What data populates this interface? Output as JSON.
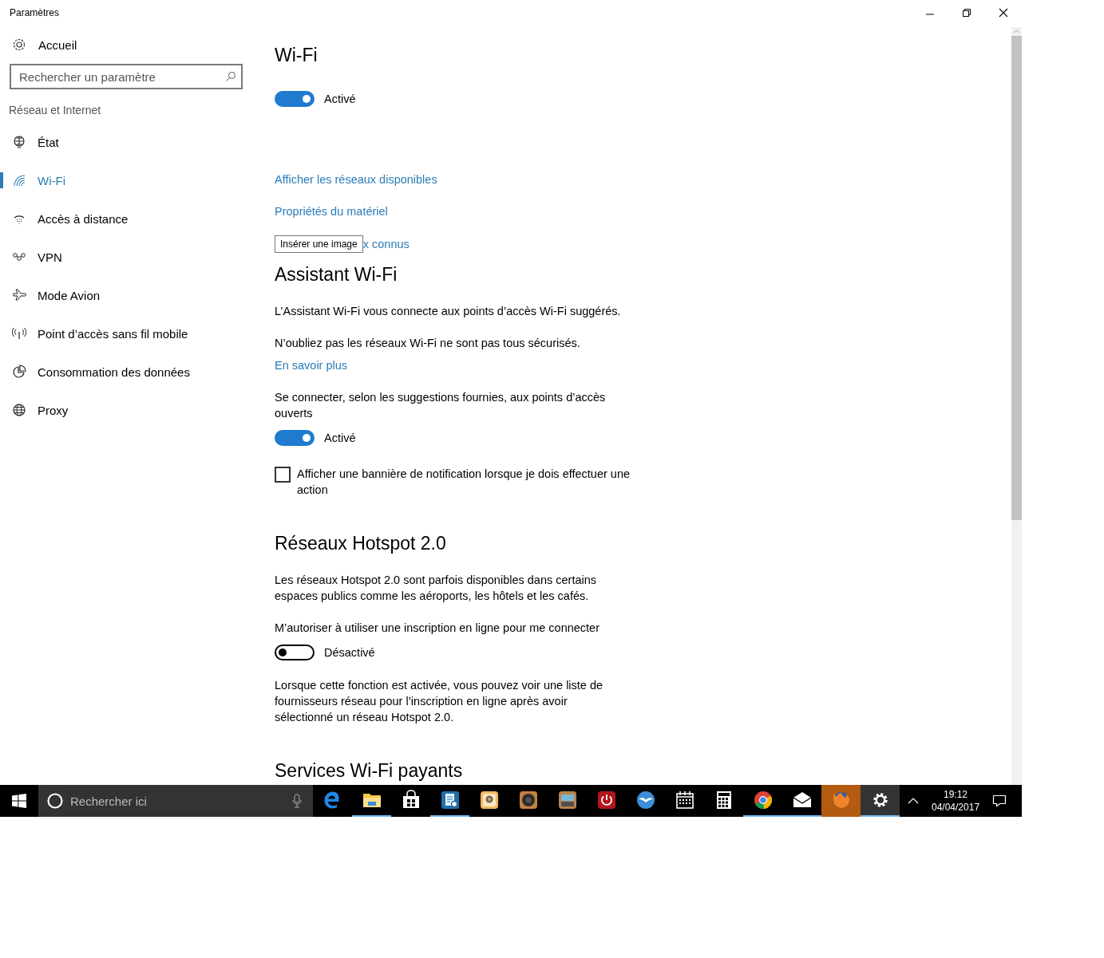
{
  "window": {
    "title": "Paramètres",
    "controls": [
      {
        "kind": "minimize"
      },
      {
        "kind": "restore"
      },
      {
        "kind": "close"
      }
    ]
  },
  "sidebar": {
    "home": {
      "label": "Accueil"
    },
    "search": {
      "placeholder": "Rechercher un paramètre"
    },
    "section": "Réseau et Internet",
    "items": [
      {
        "label": "État",
        "selected": false
      },
      {
        "label": "Wi-Fi",
        "selected": true
      },
      {
        "label": "Accès à distance",
        "selected": false
      },
      {
        "label": "VPN",
        "selected": false
      },
      {
        "label": "Mode Avion",
        "selected": false
      },
      {
        "label": "Point d’accès sans fil mobile",
        "selected": false
      },
      {
        "label": "Consommation des données",
        "selected": false
      },
      {
        "label": "Proxy",
        "selected": false
      }
    ]
  },
  "content": [
    {
      "kind": "title",
      "text": "Wi-Fi"
    },
    {
      "kind": "toggle",
      "on": true,
      "label": "Activé"
    },
    {
      "kind": "link",
      "text": "Afficher les réseaux disponibles"
    },
    {
      "kind": "link",
      "text": "Propriétés du matériel"
    },
    {
      "kind": "link",
      "text": "x connus",
      "tooltip": "Insérer une image"
    },
    {
      "kind": "heading",
      "text": "Assistant Wi-Fi"
    },
    {
      "kind": "text",
      "text": "L’Assistant Wi-Fi vous connecte aux points d’accès Wi-Fi suggérés."
    },
    {
      "kind": "text",
      "text": "N’oubliez pas les réseaux Wi-Fi ne sont pas tous sécurisés."
    },
    {
      "kind": "link",
      "text": "En savoir plus"
    },
    {
      "kind": "text",
      "text": "Se connecter, selon les suggestions fournies, aux points d’accès ouverts"
    },
    {
      "kind": "toggle",
      "on": true,
      "label": "Activé"
    },
    {
      "kind": "checkbox",
      "checked": false,
      "label": "Afficher une bannière de notification lorsque je dois effectuer une action"
    },
    {
      "kind": "heading",
      "text": "Réseaux Hotspot 2.0"
    },
    {
      "kind": "text",
      "text": "Les réseaux Hotspot 2.0 sont parfois disponibles dans certains espaces publics comme les aéroports, les hôtels et les cafés."
    },
    {
      "kind": "text",
      "text": "M’autoriser à utiliser une inscription en ligne pour me connecter"
    },
    {
      "kind": "toggle",
      "on": false,
      "label": "Désactivé"
    },
    {
      "kind": "text",
      "text": "Lorsque cette fonction est activée, vous pouvez voir une liste de fournisseurs réseau pour l’inscription en ligne après avoir sélectionné un réseau Hotspot 2.0."
    },
    {
      "kind": "heading",
      "text": "Services Wi-Fi payants"
    }
  ],
  "taskbar": {
    "search": {
      "placeholder": "Rechercher ici"
    },
    "apps": [
      {
        "kind": "edge",
        "running": false,
        "active": false,
        "flashing": false
      },
      {
        "kind": "folder",
        "running": true,
        "active": false,
        "flashing": false
      },
      {
        "kind": "store",
        "running": false,
        "active": false,
        "flashing": false
      },
      {
        "kind": "doc-gear",
        "running": true,
        "active": false,
        "flashing": false
      },
      {
        "kind": "photo",
        "running": false,
        "active": false,
        "flashing": false
      },
      {
        "kind": "speaker",
        "running": false,
        "active": false,
        "flashing": false
      },
      {
        "kind": "scanner",
        "running": false,
        "active": false,
        "flashing": false
      },
      {
        "kind": "power",
        "running": false,
        "active": false,
        "flashing": false
      },
      {
        "kind": "birds",
        "running": false,
        "active": false,
        "flashing": false
      },
      {
        "kind": "calendar",
        "running": false,
        "active": false,
        "flashing": false
      },
      {
        "kind": "calculator",
        "running": false,
        "active": false,
        "flashing": false
      },
      {
        "kind": "chrome",
        "running": true,
        "active": false,
        "flashing": false
      },
      {
        "kind": "mail",
        "running": true,
        "active": false,
        "flashing": false
      },
      {
        "kind": "firefox",
        "running": false,
        "active": false,
        "flashing": true
      },
      {
        "kind": "settings",
        "running": true,
        "active": true,
        "flashing": false
      }
    ],
    "time": "19:12",
    "date": "04/04/2017"
  }
}
